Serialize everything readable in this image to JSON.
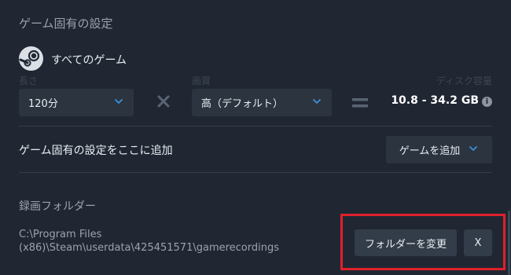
{
  "section_title": "ゲーム固有の設定",
  "all_games_label": "すべてのゲーム",
  "length": {
    "label": "長さ",
    "value": "120分"
  },
  "quality": {
    "label": "画質",
    "value": "高（デフォルト）"
  },
  "disk": {
    "label": "ディスク容量",
    "value": "10.8 - 34.2 GB"
  },
  "add_setting": {
    "label": "ゲーム固有の設定をここに追加",
    "button_label": "ゲームを追加"
  },
  "recording": {
    "title": "録画フォルダー",
    "path": "C:\\Program Files (x86)\\Steam\\userdata\\425451571\\gamerecordings",
    "change_button": "フォルダーを変更",
    "clear_button": "X"
  },
  "colors": {
    "accent": "#3d8fd6",
    "highlight": "#e0202a",
    "background": "#202733"
  },
  "icons": [
    "steam-logo-icon",
    "chevron-down-icon",
    "multiply-icon",
    "equals-icon",
    "info-icon"
  ]
}
